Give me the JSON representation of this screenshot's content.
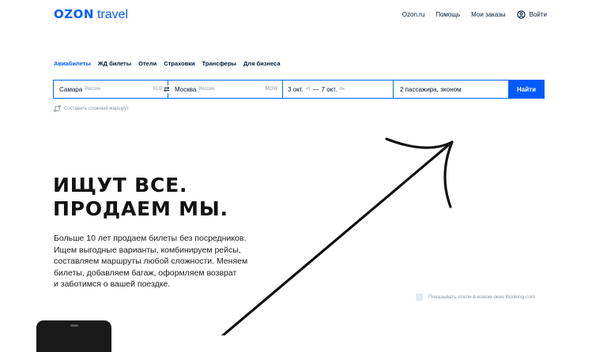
{
  "header": {
    "logo_ozon": "OZON",
    "logo_travel": "travel",
    "nav": [
      "Ozon.ru",
      "Помощь",
      "Мои заказы"
    ],
    "login_label": "Войти"
  },
  "tabs": [
    {
      "label": "Авиабилеты",
      "active": true
    },
    {
      "label": "ЖД билеты",
      "active": false
    },
    {
      "label": "Отели",
      "active": false
    },
    {
      "label": "Страховки",
      "active": false
    },
    {
      "label": "Трансферы",
      "active": false
    },
    {
      "label": "Для бизнеса",
      "active": false
    }
  ],
  "search": {
    "from_city": "Самара",
    "from_country": "Россия",
    "from_code": "KUF",
    "to_city": "Москва",
    "to_country": "Россия",
    "to_code": "MOW",
    "date_from": "3 окт.",
    "date_from_day": "чт",
    "dash": "—",
    "date_to": "7 окт.",
    "date_to_day": "пн",
    "passengers": "2 пассажира, эконом",
    "find_button": "Найти",
    "complex_route": "Составить сложный маршрут"
  },
  "hero": {
    "headline_line1": "ИЩУТ ВСЕ.",
    "headline_line2": "ПРОДАЕМ МЫ.",
    "body": [
      "Больше 10 лет продаем билеты без посредников.",
      "Ищем выгодные варианты, комбинируем рейсы,",
      "составляем маршруты любой сложности. Меняем",
      "билеты, добавляем багаж, оформляем возврат",
      "и заботимся о вашей поездке."
    ]
  },
  "booking_option": {
    "label": "Показывать отели в новом окне Booking.com",
    "checked": false
  },
  "colors": {
    "accent": "#005bff",
    "text": "#001a34",
    "muted": "#8a95a3"
  },
  "icons": [
    "swap-arrows-icon",
    "route-icon",
    "user-icon",
    "arrow-illustration"
  ]
}
